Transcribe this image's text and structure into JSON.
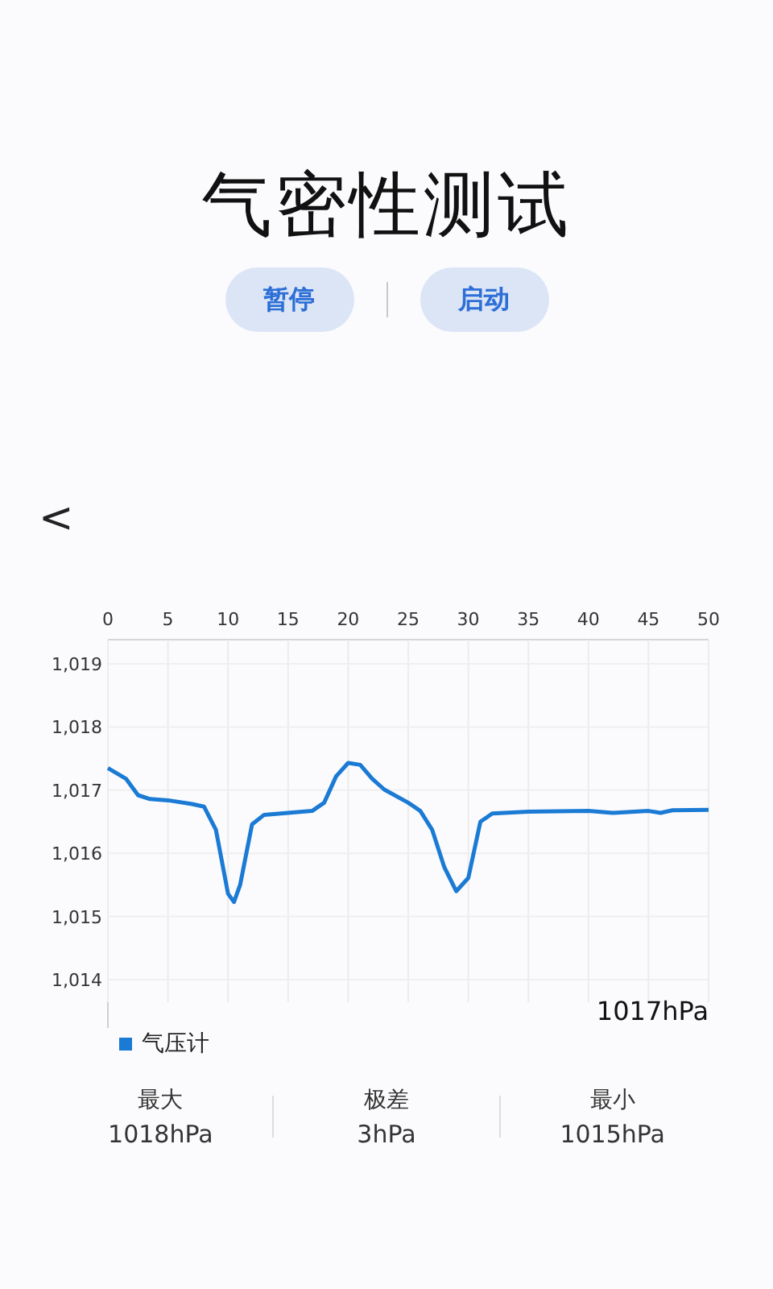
{
  "title": "气密性测试",
  "buttons": [
    {
      "label": "暂停"
    },
    {
      "label": "启动"
    }
  ],
  "back": {
    "icon": "<"
  },
  "chart": {
    "reading": "1017hPa",
    "chart_data": {
      "type": "line",
      "x": [
        0,
        1.5,
        2.5,
        3.5,
        5,
        7,
        8,
        9,
        10,
        10.5,
        11,
        12,
        13,
        15,
        17,
        18,
        19,
        20,
        21,
        22,
        23,
        25,
        26,
        27,
        28,
        29,
        30,
        31,
        32,
        35,
        40,
        42,
        45,
        46,
        47,
        50
      ],
      "series": [
        {
          "name": "气压计",
          "color": "#1a7ad4",
          "values": [
            1017.35,
            1017.18,
            1016.92,
            1016.86,
            1016.84,
            1016.78,
            1016.74,
            1016.37,
            1015.36,
            1015.23,
            1015.5,
            1016.46,
            1016.61,
            1016.64,
            1016.67,
            1016.8,
            1017.22,
            1017.43,
            1017.4,
            1017.18,
            1017.01,
            1016.8,
            1016.67,
            1016.37,
            1015.78,
            1015.4,
            1015.61,
            1016.5,
            1016.63,
            1016.66,
            1016.67,
            1016.64,
            1016.67,
            1016.64,
            1016.68,
            1016.69
          ]
        }
      ],
      "grid": true,
      "xlim": [
        0,
        50
      ],
      "ylim": [
        1014,
        1019
      ],
      "xticks": [
        0,
        5,
        10,
        15,
        20,
        25,
        30,
        35,
        40,
        45,
        50
      ],
      "yticks": [
        {
          "value": 1014,
          "label": "1,014"
        },
        {
          "value": 1015,
          "label": "1,015"
        },
        {
          "value": 1016,
          "label": "1,016"
        },
        {
          "value": 1017,
          "label": "1,017"
        },
        {
          "value": 1018,
          "label": "1,018"
        },
        {
          "value": 1019,
          "label": "1,019"
        }
      ]
    }
  },
  "stats": [
    {
      "label": "最大",
      "value": "1018hPa"
    },
    {
      "label": "极差",
      "value": "3hPa"
    },
    {
      "label": "最小",
      "value": "1015hPa"
    }
  ]
}
